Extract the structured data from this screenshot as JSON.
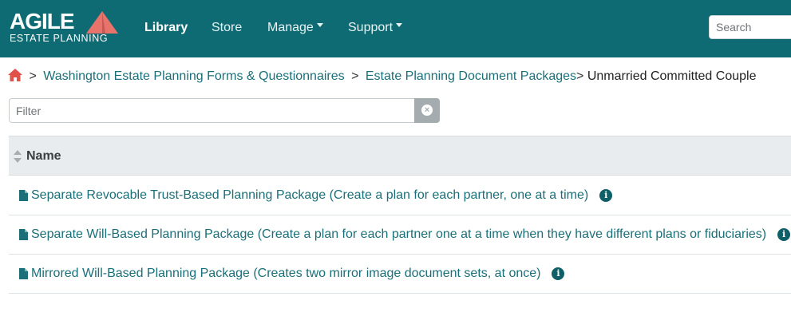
{
  "navbar": {
    "logo_word": "AGILE",
    "logo_sub": "ESTATE PLANNING",
    "links": [
      {
        "label": "Library",
        "active": true,
        "dropdown": false
      },
      {
        "label": "Store",
        "active": false,
        "dropdown": false
      },
      {
        "label": "Manage",
        "active": false,
        "dropdown": true
      },
      {
        "label": "Support",
        "active": false,
        "dropdown": true
      }
    ],
    "search_placeholder": "Search"
  },
  "breadcrumb": {
    "items": [
      "Washington Estate Planning Forms & Questionnaires",
      "Estate Planning Document Packages"
    ],
    "current": "Unmarried Committed Couple"
  },
  "filter": {
    "placeholder": "Filter"
  },
  "table": {
    "column_name": "Name",
    "rows": [
      {
        "title": "Separate Revocable Trust-Based Planning Package (Create a plan for each partner, one at a time)"
      },
      {
        "title": "Separate Will-Based Planning Package (Create a plan for each partner one at a time when they have different plans or fiduciaries)"
      },
      {
        "title": "Mirrored Will-Based Planning Package (Creates two mirror image document sets, at once)"
      }
    ]
  },
  "colors": {
    "navbar_bg": "#0f6b73",
    "link": "#1a6f78",
    "logo_accent": "#e8736a",
    "home_icon": "#e0524a"
  }
}
